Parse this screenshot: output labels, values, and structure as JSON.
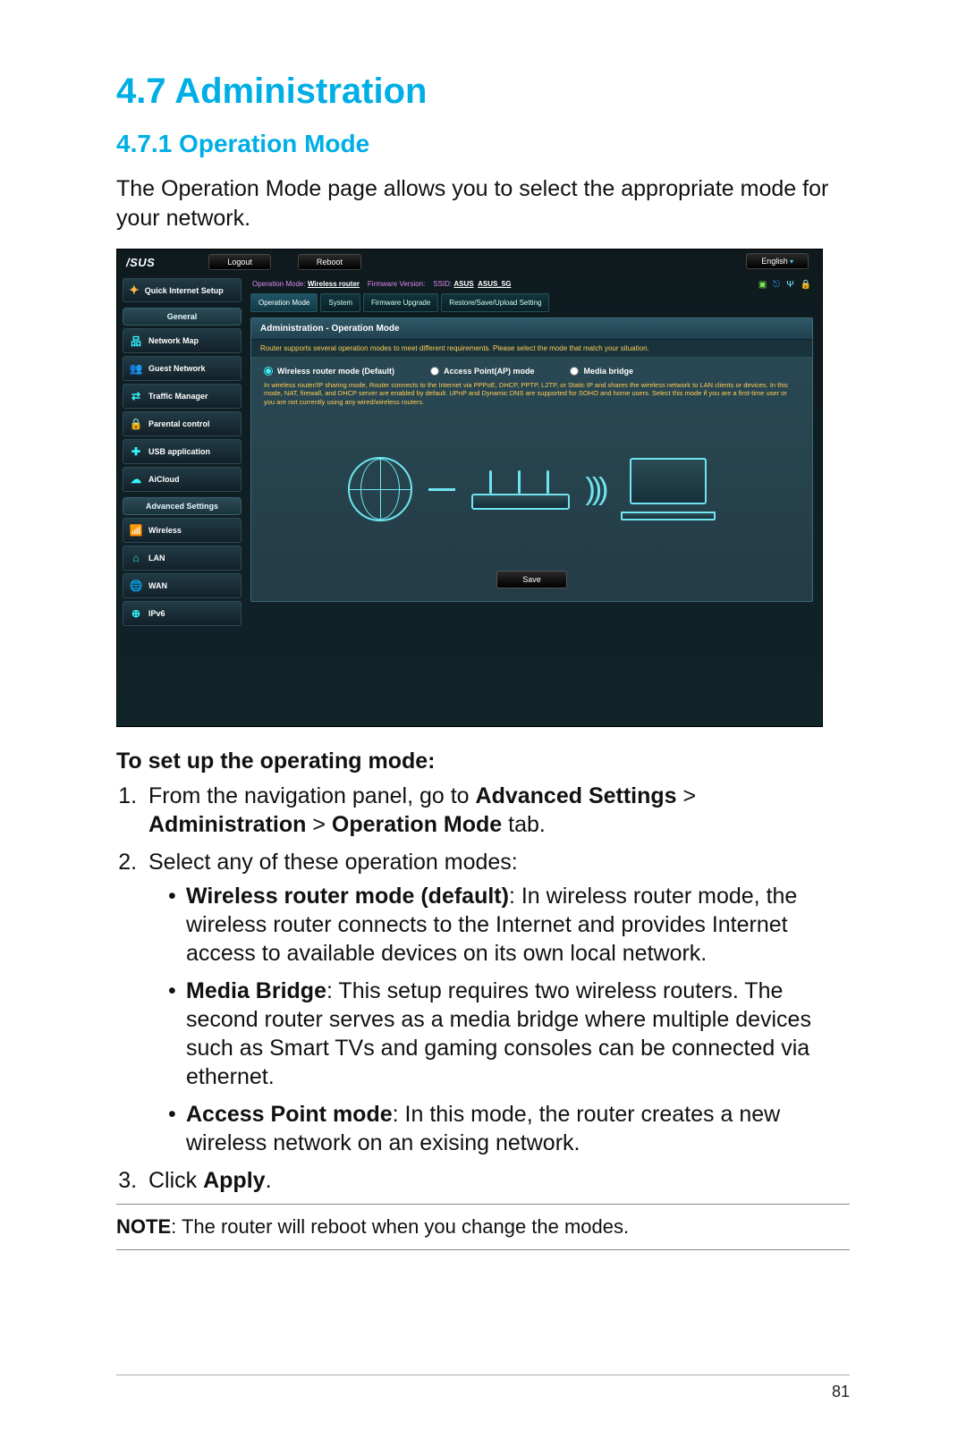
{
  "headings": {
    "section": "4.7   Administration",
    "subsection": "4.7.1 Operation Mode"
  },
  "intro": "The Operation Mode page allows you to select the appropriate mode for your network.",
  "router": {
    "brand": "/SUS",
    "logout": "Logout",
    "reboot": "Reboot",
    "lang": "English",
    "info": {
      "opmode_lbl": "Operation Mode:",
      "opmode_val": "Wireless router",
      "fw_lbl": "Firmware Version:",
      "ssid_lbl": "SSID:",
      "ssid1": "ASUS",
      "ssid2": "ASUS_5G"
    },
    "qis": "Quick Internet Setup",
    "cat_general": "General",
    "cat_adv": "Advanced Settings",
    "nav_general": [
      "Network Map",
      "Guest Network",
      "Traffic Manager",
      "Parental control",
      "USB application",
      "AiCloud"
    ],
    "nav_adv": [
      "Wireless",
      "LAN",
      "WAN",
      "IPv6"
    ],
    "tabs": [
      "Operation Mode",
      "System",
      "Firmware Upgrade",
      "Restore/Save/Upload Setting"
    ],
    "panel_title": "Administration - Operation Mode",
    "panel_sub": "Router supports several operation modes to meet different requirements. Please select the mode that match your situation.",
    "radios": {
      "wr": "Wireless router mode (Default)",
      "ap": "Access Point(AP) mode",
      "mb": "Media bridge"
    },
    "desc": "In wireless router/IP sharing mode, Router connects to the Internet via PPPoE, DHCP, PPTP, L2TP, or Static IP and shares the wireless network to LAN clients or devices. In this mode, NAT, firewall, and DHCP server are enabled by default. UPnP and Dynamic DNS are supported for SOHO and home users. Select this mode if you are a first-time user or you are not currently using any wired/wireless routers.",
    "save": "Save"
  },
  "instructions": {
    "title": "To set up the operating mode:",
    "step1_a": "From the navigation panel, go to ",
    "step1_b": "Advanced Settings",
    "step1_c": " > ",
    "step1_d": "Administration",
    "step1_e": " > ",
    "step1_f": "Operation Mode",
    "step1_g": " tab.",
    "step2": "Select any of these operation modes:",
    "b1_t": "Wireless router mode (default)",
    "b1_d": ": In wireless router mode, the wireless router connects to the Internet and provides Internet access to available devices on its own local network.",
    "b2_t": "Media Bridge",
    "b2_d": ": This setup requires two wireless routers. The second router serves as a media bridge where multiple devices such as Smart TVs and gaming consoles can be connected via ethernet.",
    "b3_t": "Access Point mode",
    "b3_d": ": In this mode, the router creates a new wireless network on an exising network.",
    "step3_a": "Click ",
    "step3_b": "Apply",
    "step3_c": "."
  },
  "note": {
    "label": "NOTE",
    "text": ":  The router will reboot when you change the modes."
  },
  "pagenum": "81"
}
